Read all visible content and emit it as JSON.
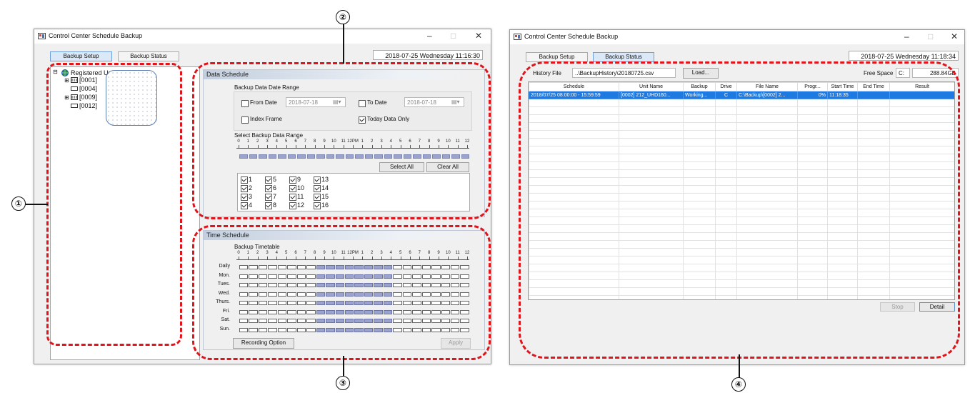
{
  "left_window": {
    "title": "Control Center Schedule Backup",
    "tabs": [
      "Backup Setup",
      "Backup Status"
    ],
    "active_tab": "Backup Setup",
    "datetime": "2018-07-25  Wednesday  11:16:30",
    "tree": {
      "root": "Registered Units",
      "items": [
        "[0001]",
        "[0004]",
        "[0009]",
        "[0012]"
      ]
    },
    "data_schedule": {
      "header": "Data Schedule",
      "range_label": "Backup Data Date Range",
      "from_label": "From Date",
      "from_value": "2018-07-18",
      "to_label": "To Date",
      "to_value": "2018-07-18",
      "index_frame_label": "Index Frame",
      "today_only_label": "Today Data Only",
      "select_range_label": "Select Backup Data Range",
      "select_all": "Select All",
      "clear_all": "Clear All",
      "channels": [
        "1",
        "2",
        "3",
        "4",
        "5",
        "6",
        "7",
        "8",
        "9",
        "10",
        "11",
        "12",
        "13",
        "14",
        "15",
        "16"
      ]
    },
    "ruler_labels": [
      "0",
      "1",
      "2",
      "3",
      "4",
      "5",
      "6",
      "7",
      "8",
      "9",
      "10",
      "11",
      "12PM",
      "1",
      "2",
      "3",
      "4",
      "5",
      "6",
      "7",
      "8",
      "9",
      "10",
      "11",
      "12"
    ],
    "time_schedule": {
      "header": "Time Schedule",
      "timetable_label": "Backup Timetable",
      "days": [
        "Daily",
        "Mon.",
        "Tues.",
        "Wed.",
        "Thurs.",
        "Fri.",
        "Sat.",
        "Sun."
      ],
      "recording_option": "Recording Option",
      "apply": "Apply"
    }
  },
  "right_window": {
    "title": "Control Center Schedule Backup",
    "tabs": [
      "Backup Setup",
      "Backup Status"
    ],
    "active_tab": "Backup Status",
    "datetime": "2018-07-25  Wednesday  11:18:34",
    "history_label": "History File",
    "history_value": "..\\BackupHistory\\20180725.csv",
    "load_button": "Load...",
    "free_space_label": "Free Space",
    "drive": "C:",
    "free_space_value": "288.84GB",
    "columns": [
      "Schedule",
      "Unit Name",
      "Backup",
      "Drive",
      "File Name",
      "Progr...",
      "Start Time",
      "End Time",
      "Result"
    ],
    "rows": [
      [
        "2018/07/25  08:00:00 - 15:59:59",
        "[0002] 212_UHD160...",
        "Working...",
        "C",
        "C:\\Backup\\[0002] 2...",
        "0%",
        "11:18:35",
        "",
        ""
      ]
    ],
    "stop_button": "Stop",
    "detail_button": "Detail"
  },
  "callouts": [
    "①",
    "②",
    "③",
    "④"
  ]
}
